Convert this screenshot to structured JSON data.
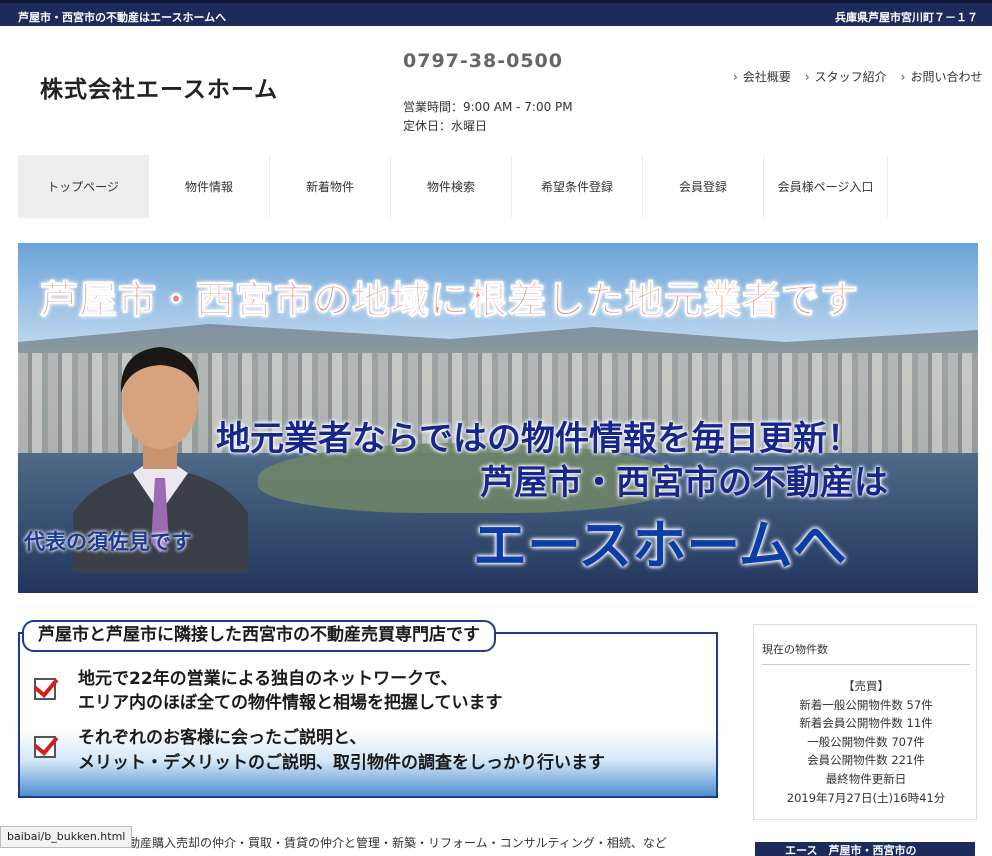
{
  "topbar": {
    "tagline": "芦屋市・西宮市の不動産はエースホームへ",
    "address": "兵庫県芦屋市宮川町７－１７"
  },
  "header": {
    "company_name": "株式会社エースホーム",
    "phone": "0797-38-0500",
    "hours": "営業時間：9:00 AM - 7:00 PM",
    "closed": "定休日：水曜日",
    "links": [
      "会社概要",
      "スタッフ紹介",
      "お問い合わせ"
    ]
  },
  "nav": {
    "items": [
      "トップページ",
      "物件情報",
      "新着物件",
      "物件検索",
      "希望条件登録",
      "会員登録",
      "会員様ページ入口"
    ],
    "active_index": 0
  },
  "banner": {
    "headline": "芦屋市・西宮市の地域に根差した地元業者です",
    "line1": "地元業者ならではの物件情報を毎日更新！",
    "line2": "芦屋市・西宮市の不動産は",
    "line3": "エースホームへ",
    "caption": "代表の須佐見です"
  },
  "promo": {
    "heading": "芦屋市と芦屋市に隣接した西宮市の不動産売買専門店です",
    "points": [
      [
        "地元で22年の営業による独自のネットワークで、",
        "エリア内のほぼ全ての物件情報と相場を把握しています"
      ],
      [
        "それぞれのお客様に会ったご説明と、",
        "メリット・デメリットのご説明、取引物件の調査をしっかり行います"
      ]
    ]
  },
  "sidebar": {
    "title": "現在の物件数",
    "lines": [
      "【売買】",
      "新着一般公開物件数 57件",
      "新着会員公開物件数 11件",
      "一般公開物件数 707件",
      "会員公開物件数 221件",
      "最終物件更新日",
      "2019年7月27日(土)16時41分"
    ],
    "banner_partial": "エース　芦屋市・西宮市の"
  },
  "body": {
    "text": "動産購入売却の仲介・買取・賃貸の仲介と管理・新築・リフォーム・コンサルティング・相続、など"
  },
  "status": {
    "url": "baibai/b_bukken.html"
  },
  "colors": {
    "navy": "#1c2a5c",
    "banner_title": "#f0836e",
    "banner_blue": "#0b3ca8",
    "check_red": "#d41d1d"
  }
}
